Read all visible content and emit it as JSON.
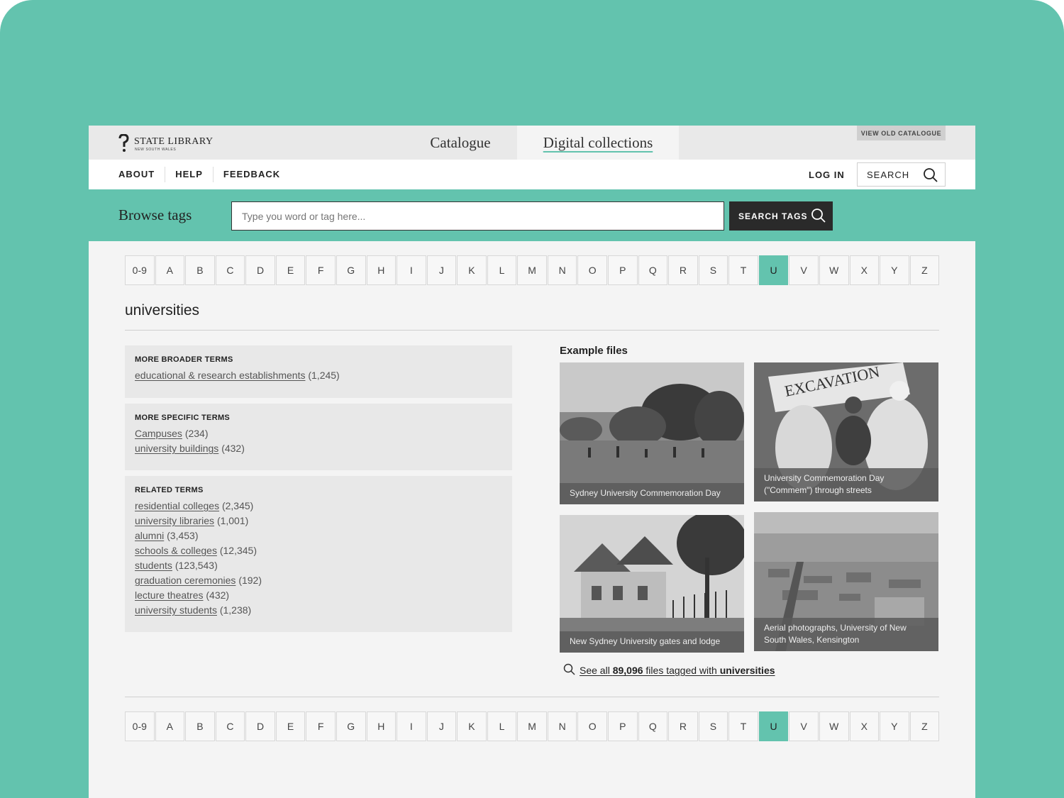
{
  "brand": {
    "name": "STATE LIBRARY",
    "sub": "NEW SOUTH WALES"
  },
  "tabs": {
    "catalogue": "Catalogue",
    "digital": "Digital collections"
  },
  "view_old_catalogue": "VIEW OLD CATALOGUE",
  "nav": {
    "about": "ABOUT",
    "help": "HELP",
    "feedback": "FEEDBACK",
    "login": "LOG IN",
    "search": "SEARCH"
  },
  "browse": {
    "title": "Browse tags",
    "placeholder": "Type you word or tag here...",
    "button": "SEARCH TAGS"
  },
  "alphabet": [
    "0-9",
    "A",
    "B",
    "C",
    "D",
    "E",
    "F",
    "G",
    "H",
    "I",
    "J",
    "K",
    "L",
    "M",
    "N",
    "O",
    "P",
    "Q",
    "R",
    "S",
    "T",
    "U",
    "V",
    "W",
    "X",
    "Y",
    "Z"
  ],
  "active_letter": "U",
  "heading": "universities",
  "broader": {
    "title": "MORE BROADER TERMS",
    "items": [
      {
        "label": "educational & research establishments",
        "count": "(1,245)"
      }
    ]
  },
  "specific": {
    "title": "MORE SPECIFIC TERMS",
    "items": [
      {
        "label": "Campuses",
        "count": "(234)"
      },
      {
        "label": "university buildings",
        "count": "(432)"
      }
    ]
  },
  "related": {
    "title": "RELATED TERMS",
    "items": [
      {
        "label": "residential colleges",
        "count": "(2,345)"
      },
      {
        "label": "university libraries",
        "count": "(1,001)"
      },
      {
        "label": "alumni",
        "count": "(3,453)"
      },
      {
        "label": "schools & colleges",
        "count": "(12,345)"
      },
      {
        "label": "students",
        "count": "(123,543)"
      },
      {
        "label": "graduation ceremonies",
        "count": "(192)"
      },
      {
        "label": "lecture theatres",
        "count": "(432)"
      },
      {
        "label": "university students",
        "count": "(1,238)"
      }
    ]
  },
  "examples": {
    "title": "Example files",
    "items": [
      {
        "caption": "Sydney University Commemoration Day"
      },
      {
        "caption": "University Commemoration Day (\"Commem\") through streets",
        "sign": "EXCAVATION"
      },
      {
        "caption": "New Sydney University gates and lodge"
      },
      {
        "caption": "Aerial photographs, University of New South Wales, Kensington"
      }
    ]
  },
  "see_all": {
    "prefix": "See all ",
    "count": "89,096",
    "middle": " files tagged with ",
    "tag": "universities"
  },
  "colors": {
    "accent": "#63c3ae",
    "dark_button": "#2a2a2a",
    "panel": "#e8e8e8",
    "page": "#f4f4f4"
  }
}
